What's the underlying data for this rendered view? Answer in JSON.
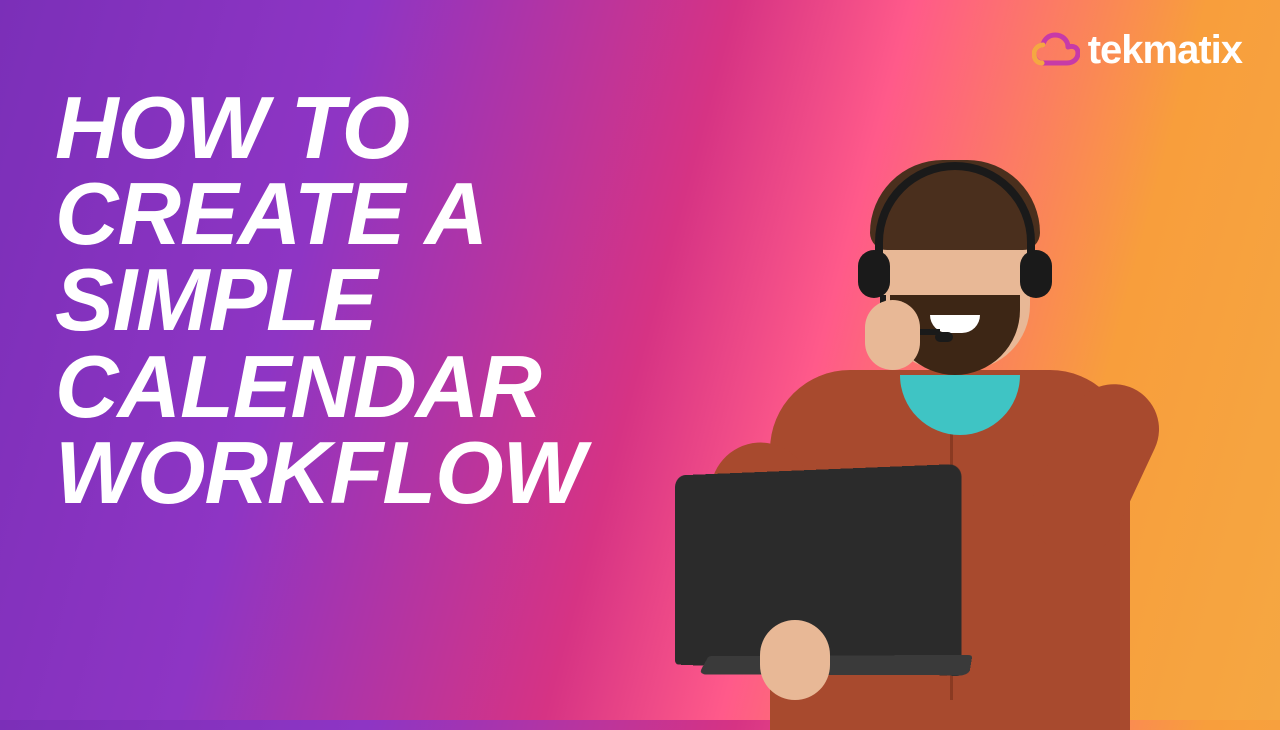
{
  "brand": {
    "name": "tekmatix"
  },
  "title": {
    "line1": "HOW TO",
    "line2": "CREATE A",
    "line3": "SIMPLE",
    "line4": "CALENDAR",
    "line5": "WORKFLOW"
  }
}
